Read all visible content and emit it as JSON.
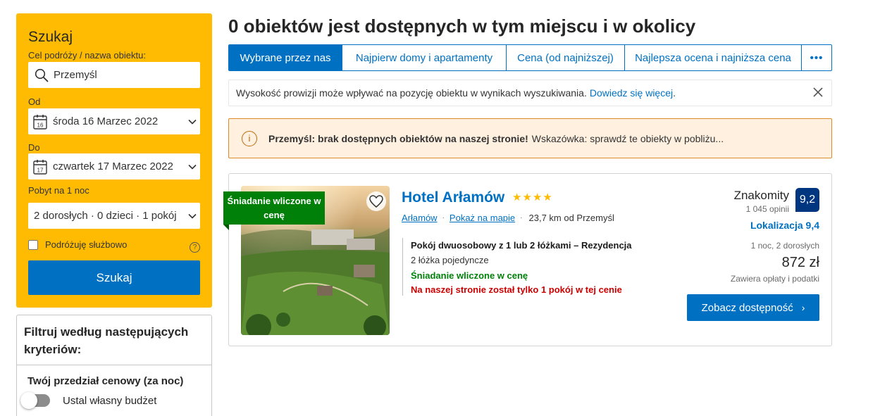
{
  "search": {
    "title": "Szukaj",
    "destination_label": "Cel podróży / nazwa obiektu:",
    "destination_value": "Przemyśl",
    "checkin_label": "Od",
    "checkin_value": "środa 16 Marzec 2022",
    "checkin_day": "16",
    "checkout_label": "Do",
    "checkout_value": "czwartek 17 Marzec 2022",
    "checkout_day": "17",
    "stay_label": "Pobyt na 1 noc",
    "guests_value": "2 dorosłych · 0 dzieci · 1 pokój",
    "business_label": "Podróżuję służbowo",
    "help_glyph": "?",
    "button_label": "Szukaj"
  },
  "filters": {
    "title": "Filtruj według następujących kryteriów:",
    "budget_title": "Twój przedział cenowy (za noc)",
    "budget_toggle_label": "Ustal własny budżet"
  },
  "main": {
    "heading": "0 obiektów jest dostępnych w tym miejscu i w okolicy",
    "tabs": [
      {
        "label": "Wybrane przez nas"
      },
      {
        "label": "Najpierw domy i apartamenty"
      },
      {
        "label": "Cena (od najniższej)"
      },
      {
        "label": "Najlepsza ocena i najniższa cena"
      },
      {
        "label": "•••"
      }
    ],
    "commission_text": "Wysokość prowizji może wpływać na pozycję obiektu w wynikach wyszukiwania.",
    "commission_link": "Dowiedz się więcej",
    "commission_end": ".",
    "alert_bold": "Przemyśl: brak dostępnych obiektów na naszej stronie!",
    "alert_text": "Wskazówka: sprawdź te obiekty w pobliżu...",
    "alert_icon": "i"
  },
  "hotel": {
    "name": "Hotel Arłamów",
    "stars": 4,
    "ribbon": "Śniadanie wliczone w cenę",
    "location_link": "Arłamów",
    "map_link": "Pokaż na mapie",
    "distance": "23,7 km od Przemyśl",
    "room_title": "Pokój dwuosobowy z 1 lub 2 łóżkami – Rezydencja",
    "room_beds": "2 łóżka pojedyncze",
    "breakfast": "Śniadanie wliczone w cenę",
    "last_room": "Na naszej stronie został tylko 1 pokój w tej cenie",
    "score_label": "Znakomity",
    "reviews": "1 045 opinii",
    "score": "9,2",
    "location_score": "Lokalizacja 9,4",
    "stay_info": "1 noc, 2 dorosłych",
    "price": "872 zł",
    "taxes": "Zawiera opłaty i podatki",
    "button_label": "Zobacz dostępność",
    "button_arrow": "›"
  },
  "colors": {
    "brand_blue": "#0071c2",
    "search_yellow": "#febb02",
    "score_navy": "#003580",
    "green": "#008009",
    "red": "#cc0000"
  }
}
